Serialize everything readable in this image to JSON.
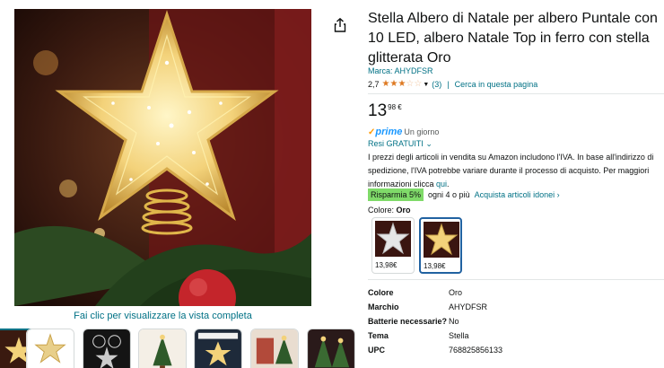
{
  "product": {
    "title": "Stella Albero di Natale per albero Puntale con 10 LED, albero Natale Top in ferro con stella glitterata Oro",
    "brand_link": "Marca: AHYDFSR",
    "rating_value": "2,7",
    "review_count": "(3)",
    "search_page_link": "Cerca in questa pagina",
    "rating_stars": 2.7
  },
  "price": {
    "whole": "13",
    "fraction": "98 €"
  },
  "prime": {
    "check": "✓",
    "label": "prime",
    "detail": "Un giorno"
  },
  "returns": {
    "label": "Resi GRATUITI",
    "chevron": "⌄"
  },
  "vat_notice": {
    "text": "I prezzi degli articoli in vendita su Amazon includono l'IVA. In base all'indirizzo di spedizione, l'IVA potrebbe variare durante il processo di acquisto. Per maggiori informazioni clicca ",
    "link": "qui",
    "period": "."
  },
  "savings": {
    "badge": "Risparmia 5%",
    "condition": "ogni 4 o più",
    "link": "Acquista articoli idonei ›"
  },
  "color_selector": {
    "label": "Colore:",
    "selected": "Oro",
    "options": [
      {
        "price": "13,98€",
        "variant": "silver"
      },
      {
        "price": "13,98€",
        "variant": "gold"
      }
    ]
  },
  "specs": [
    {
      "key": "Colore",
      "value": "Oro"
    },
    {
      "key": "Marchio",
      "value": "AHYDFSR"
    },
    {
      "key": "Batterie necessarie?",
      "value": "No"
    },
    {
      "key": "Tema",
      "value": "Stella"
    },
    {
      "key": "UPC",
      "value": "768825856133"
    }
  ],
  "gallery": {
    "zoom_link": "Fai clic per visualizzare la vista completa",
    "thumbnail_count": 7
  },
  "icons": {
    "share": "share-icon"
  },
  "colors": {
    "link": "#007185",
    "star": "#de7921",
    "prime": "#1a98ff",
    "save_badge": "#7fda69",
    "selected_border": "#2162a1"
  }
}
